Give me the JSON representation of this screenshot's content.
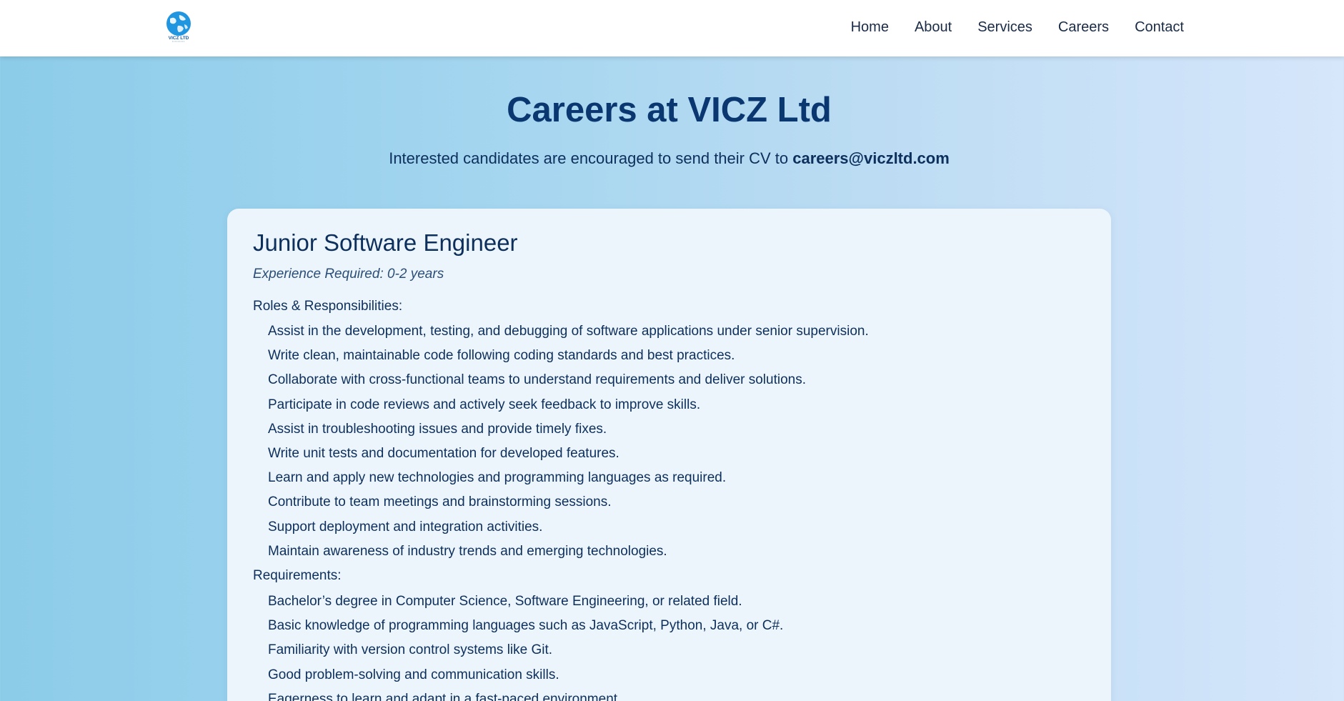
{
  "header": {
    "logo_text": "VICZ LTD",
    "nav": [
      {
        "label": "Home"
      },
      {
        "label": "About"
      },
      {
        "label": "Services"
      },
      {
        "label": "Careers"
      },
      {
        "label": "Contact"
      }
    ]
  },
  "hero": {
    "title": "Careers at VICZ Ltd",
    "subtitle_prefix": "Interested candidates are encouraged to send their CV to ",
    "email": "careers@viczltd.com"
  },
  "job": {
    "title": "Junior Software Engineer",
    "experience": "Experience Required: 0-2 years",
    "roles_label": "Roles & Responsibilities:",
    "roles": [
      "Assist in the development, testing, and debugging of software applications under senior supervision.",
      "Write clean, maintainable code following coding standards and best practices.",
      "Collaborate with cross-functional teams to understand requirements and deliver solutions.",
      "Participate in code reviews and actively seek feedback to improve skills.",
      "Assist in troubleshooting issues and provide timely fixes.",
      "Write unit tests and documentation for developed features.",
      "Learn and apply new technologies and programming languages as required.",
      "Contribute to team meetings and brainstorming sessions.",
      "Support deployment and integration activities.",
      "Maintain awareness of industry trends and emerging technologies."
    ],
    "requirements_label": "Requirements:",
    "requirements": [
      "Bachelor’s degree in Computer Science, Software Engineering, or related field.",
      "Basic knowledge of programming languages such as JavaScript, Python, Java, or C#.",
      "Familiarity with version control systems like Git.",
      "Good problem-solving and communication skills.",
      "Eagerness to learn and adapt in a fast-paced environment."
    ]
  },
  "colors": {
    "accent": "#0a3770",
    "text": "#0d2f5c",
    "logo_blue": "#2196e0"
  }
}
